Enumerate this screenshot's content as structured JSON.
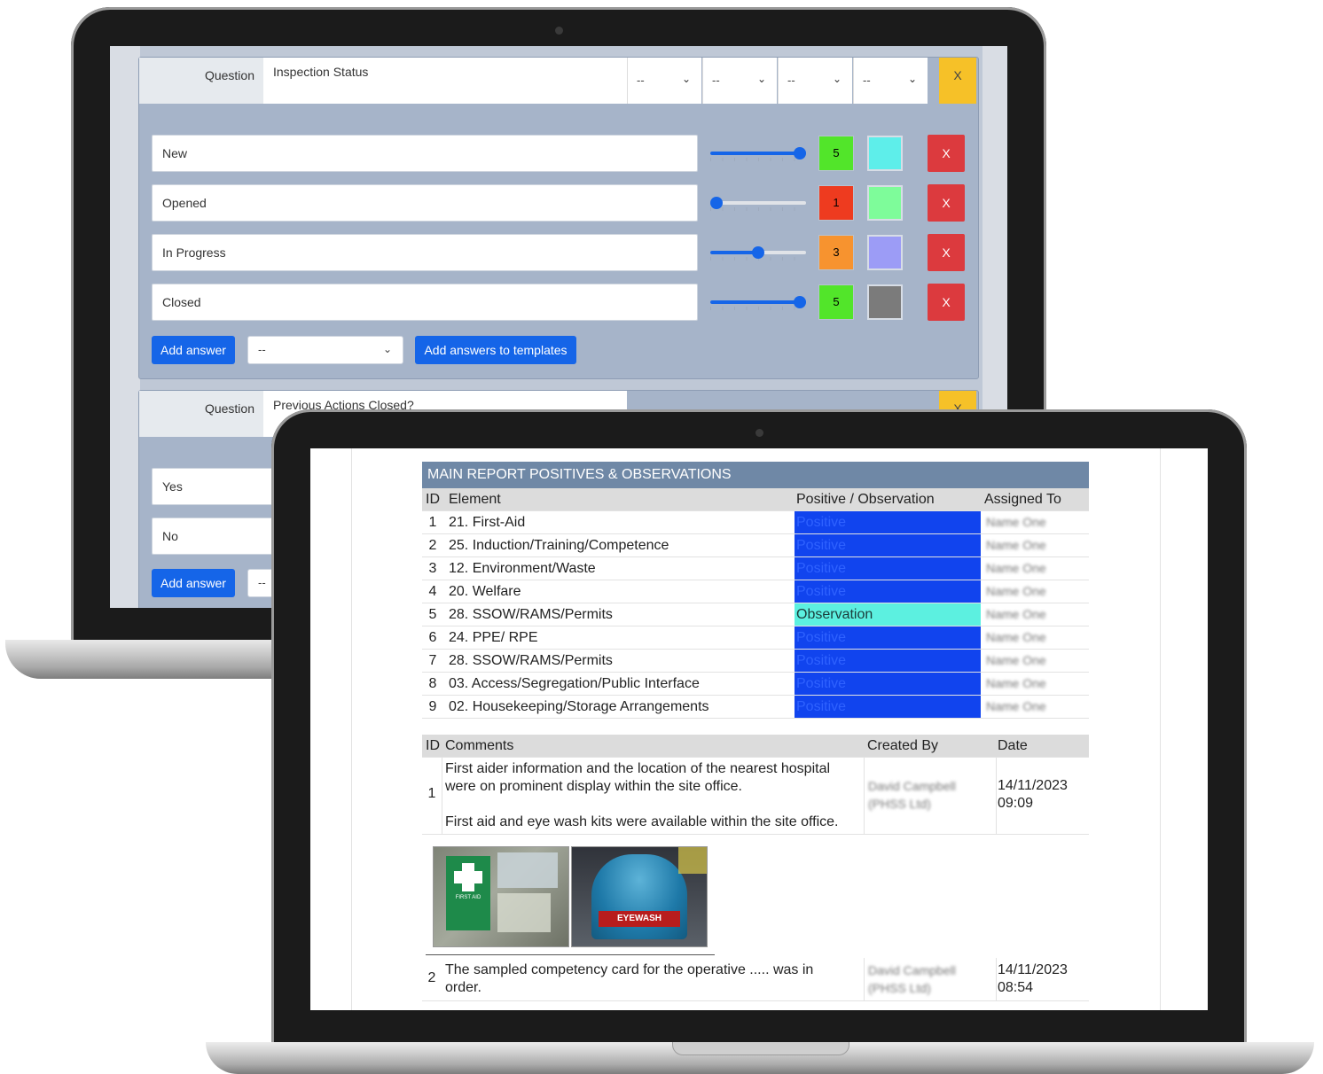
{
  "editor": {
    "question1": {
      "label": "Question",
      "text": "Inspection Status",
      "selects": [
        "--",
        "--",
        "--",
        "--"
      ],
      "remove_label": "X",
      "answers": [
        {
          "label": "New",
          "score": "5",
          "score_color": "#52e52a",
          "slider_value": 5,
          "swatch_color": "#5eeeea",
          "remove": "X"
        },
        {
          "label": "Opened",
          "score": "1",
          "score_color": "#ee3b1f",
          "slider_value": 1,
          "swatch_color": "#7efc9a",
          "remove": "X"
        },
        {
          "label": "In Progress",
          "score": "3",
          "score_color": "#f7932f",
          "slider_value": 3,
          "swatch_color": "#9c9cf6",
          "remove": "X"
        },
        {
          "label": "Closed",
          "score": "5",
          "score_color": "#52e52a",
          "slider_value": 5,
          "swatch_color": "#7b7b7b",
          "remove": "X"
        }
      ],
      "add_answer": "Add answer",
      "template_select": "--",
      "add_to_templates": "Add answers to templates"
    },
    "question2": {
      "label": "Question",
      "text": "Previous Actions Closed?",
      "remove_label": "X",
      "answers": [
        {
          "label": "Yes"
        },
        {
          "label": "No"
        }
      ],
      "add_answer": "Add answer",
      "template_select": "--"
    }
  },
  "report": {
    "title": "MAIN REPORT POSITIVES & OBSERVATIONS",
    "headers": {
      "id": "ID",
      "element": "Element",
      "type": "Positive / Observation",
      "assigned": "Assigned To"
    },
    "rows": [
      {
        "id": "1",
        "element": "21. First-Aid",
        "type": "Positive",
        "assigned": "Name One"
      },
      {
        "id": "2",
        "element": "25. Induction/Training/Competence",
        "type": "Positive",
        "assigned": "Name One"
      },
      {
        "id": "3",
        "element": "12. Environment/Waste",
        "type": "Positive",
        "assigned": "Name One"
      },
      {
        "id": "4",
        "element": "20. Welfare",
        "type": "Positive",
        "assigned": "Name One"
      },
      {
        "id": "5",
        "element": "28. SSOW/RAMS/Permits",
        "type": "Observation",
        "assigned": "Name One"
      },
      {
        "id": "6",
        "element": "24. PPE/ RPE",
        "type": "Positive",
        "assigned": "Name One"
      },
      {
        "id": "7",
        "element": "28. SSOW/RAMS/Permits",
        "type": "Positive",
        "assigned": "Name One"
      },
      {
        "id": "8",
        "element": "03. Access/Segregation/Public Interface",
        "type": "Positive",
        "assigned": "Name One"
      },
      {
        "id": "9",
        "element": "02. Housekeeping/Storage Arrangements",
        "type": "Positive",
        "assigned": "Name One"
      }
    ],
    "colors": {
      "positive": "#1144ee",
      "observation": "#5cf0e0",
      "header_bar": "#6f88a6"
    },
    "comments_headers": {
      "id": "ID",
      "comments": "Comments",
      "created_by": "Created By",
      "date": "Date"
    },
    "comments": [
      {
        "id": "1",
        "line1": "First aider information and the location of the nearest hospital",
        "line2": "were on prominent display within the site office.",
        "line3": "First aid and eye wash kits were available within the site office.",
        "created_by_1": "David Campbell",
        "created_by_2": "(PHSS Ltd)",
        "date": "14/11/2023",
        "time": "09:09"
      },
      {
        "id": "2",
        "line1": "The sampled competency card for the operative ..... was in",
        "line2": "order.",
        "created_by_1": "David Campbell",
        "created_by_2": "(PHSS Ltd)",
        "date": "14/11/2023",
        "time": "08:54"
      }
    ],
    "photos": {
      "first_aid_sign_text": "FIRST AID",
      "eyewash_text": "EYEWASH"
    }
  }
}
